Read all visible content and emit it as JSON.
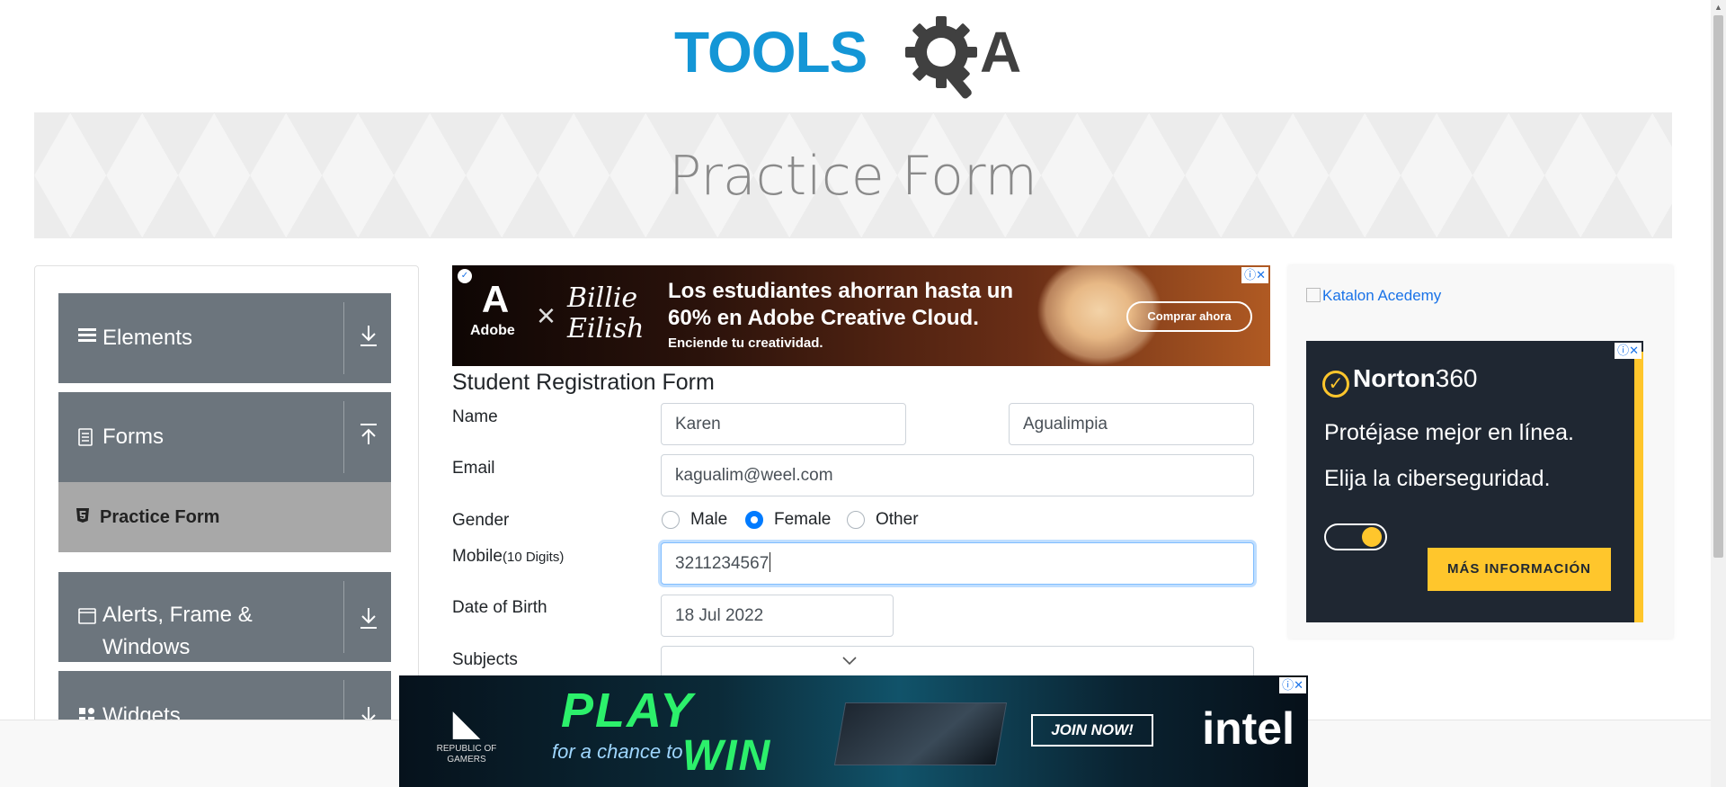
{
  "header": {
    "logo_text_main": "TOOLS",
    "logo_text_q": "Q",
    "logo_text_a": "A"
  },
  "banner": {
    "title": "Practice Form"
  },
  "sidebar": {
    "groups": [
      {
        "label": "Elements",
        "icon": "hamburger-icon",
        "arrow": "download-arrow-icon"
      },
      {
        "label": "Forms",
        "icon": "document-icon",
        "arrow": "upload-arrow-icon"
      },
      {
        "label": "Alerts, Frame & Windows",
        "icon": "window-icon",
        "arrow": "download-arrow-icon"
      },
      {
        "label": "Widgets",
        "icon": "widgets-icon",
        "arrow": "download-arrow-icon"
      }
    ],
    "active_item": {
      "label": "Practice Form",
      "icon": "html5-icon"
    }
  },
  "ads": {
    "top": {
      "brand": "Adobe",
      "x": "×",
      "partner": "Billie Eilish",
      "headline": "Los estudiantes ahorran hasta un 60% en Adobe Creative Cloud.",
      "subline": "Enciende tu creatividad.",
      "cta": "Comprar ahora"
    },
    "katalon": {
      "text": "Katalon Acedemy"
    },
    "norton": {
      "brand": "Norton",
      "brand_num": "360",
      "line1": "Protéjase mejor en línea.",
      "line2": "Elija la ciberseguridad.",
      "cta": "MÁS INFORMACIÓN"
    },
    "bottom": {
      "rog": "REPUBLIC OF GAMERS",
      "play": "PLAY",
      "chance": "for a chance to",
      "win": "WIN",
      "cta": "JOIN NOW!",
      "intel": "intel"
    },
    "ad_controls": "ⓘ✕"
  },
  "form": {
    "title": "Student Registration Form",
    "name_label": "Name",
    "first_name": "Karen",
    "last_name": "Agualimpia",
    "email_label": "Email",
    "email": "kagualim@weel.com",
    "gender_label": "Gender",
    "gender_options": [
      "Male",
      "Female",
      "Other"
    ],
    "gender_selected": "Female",
    "mobile_label": "Mobile",
    "mobile_hint": "(10 Digits)",
    "mobile": "3211234567",
    "dob_label": "Date of Birth",
    "dob": "18 Jul 2022",
    "subjects_label": "Subjects",
    "subjects_value": ""
  },
  "colors": {
    "brand_blue": "#1496d6",
    "brand_dark": "#404040",
    "sidebar_group": "#6c757d",
    "sidebar_active": "#a8a8a8",
    "radio_checked": "#007bff",
    "norton_yellow": "#ffc62c"
  }
}
